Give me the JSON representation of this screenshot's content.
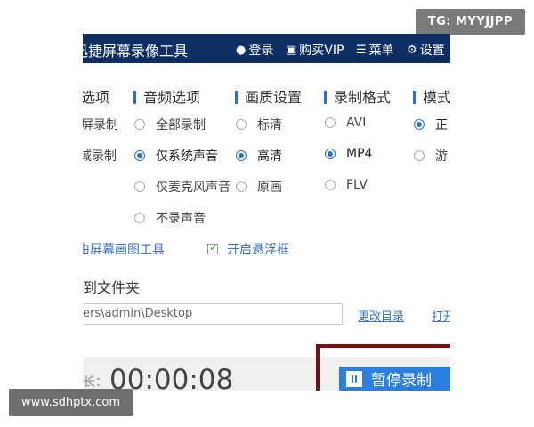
{
  "watermarks": {
    "top": "TG: MYYJJPP",
    "bottom": "www.sdhptx.com"
  },
  "titlebar": {
    "app_title": "迅捷屏幕录像工具",
    "login": "登录",
    "buy_vip": "购买VIP",
    "menu": "菜单",
    "settings": "设置"
  },
  "sections": {
    "video_options": "选项",
    "audio_options": "音频选项",
    "quality": "画质设置",
    "format": "录制格式",
    "mode": "模式"
  },
  "video_options": [
    "屏录制",
    "域录制"
  ],
  "audio_options": [
    {
      "label": "全部录制",
      "selected": false
    },
    {
      "label": "仅系统声音",
      "selected": true
    },
    {
      "label": "仅麦克风声音",
      "selected": false
    },
    {
      "label": "不录声音",
      "selected": false
    }
  ],
  "quality_options": [
    {
      "label": "标清",
      "selected": false
    },
    {
      "label": "高清",
      "selected": true
    },
    {
      "label": "原画",
      "selected": false
    }
  ],
  "format_options": [
    {
      "label": "AVI",
      "selected": false
    },
    {
      "label": "MP4",
      "selected": true
    },
    {
      "label": "FLV",
      "selected": false
    }
  ],
  "mode_options": [
    {
      "label": "正",
      "selected": true
    },
    {
      "label": "游",
      "selected": false
    }
  ],
  "tools": {
    "draw_tool_link": "由屏幕画图工具",
    "float_checkbox_label": "开启悬浮框",
    "float_checked": true
  },
  "save": {
    "label": "到文件夹",
    "path": "ers\\admin\\Desktop",
    "change_dir": "更改目录",
    "open": "打开"
  },
  "recording": {
    "duration_label": "长：",
    "duration": "00:00:08",
    "pause_label": "暂停录制"
  }
}
